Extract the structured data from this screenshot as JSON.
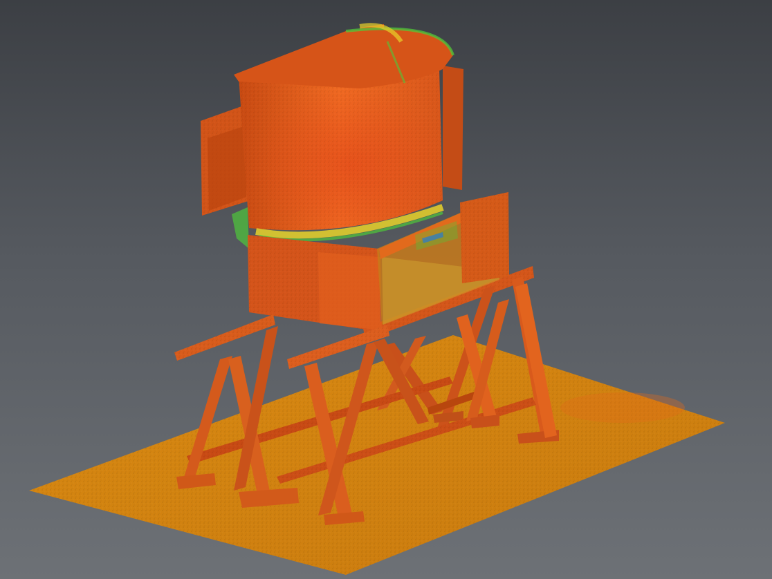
{
  "viewer": {
    "background_top": "#3c3f44",
    "background_bottom": "#6d7176"
  },
  "scene": {
    "object": "point-cloud-hopper-on-trestles",
    "palette": {
      "floor": "#d98a12",
      "floor_dark": "#b8700c",
      "steel": "#e0601a",
      "steel_dark": "#b8420e",
      "steel_light": "#f07a2a",
      "highlight_yellow": "#e8d22a",
      "highlight_green": "#4fc83a",
      "highlight_blue": "#2a7bd0"
    }
  }
}
